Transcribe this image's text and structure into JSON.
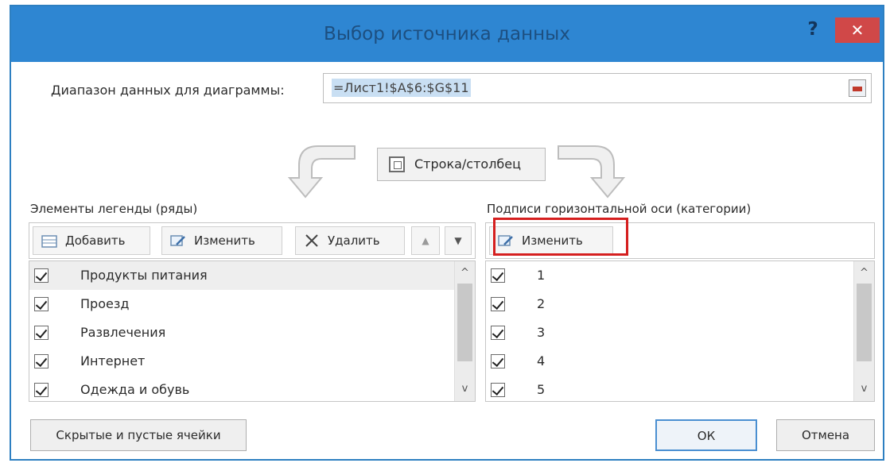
{
  "window": {
    "title": "Выбор источника данных",
    "help_label": "?",
    "close_label": "✕"
  },
  "data_range": {
    "label": "Диапазон данных для диаграммы:",
    "value": "=Лист1!$A$6:$G$11",
    "picker_icon": "range-collapse-icon"
  },
  "switch_row_col": {
    "label": "Строка/столбец",
    "icon": "switch-row-column-icon"
  },
  "legend_panel": {
    "label": "Элементы легенды (ряды)",
    "add_label": "Добавить",
    "edit_label": "Изменить",
    "delete_label": "Удалить",
    "move_up_label": "▲",
    "move_down_label": "▼",
    "items": [
      {
        "label": "Продукты питания",
        "checked": true,
        "selected": true
      },
      {
        "label": "Проезд",
        "checked": true
      },
      {
        "label": "Развлечения",
        "checked": true
      },
      {
        "label": "Интернет",
        "checked": true
      },
      {
        "label": "Одежда и обувь",
        "checked": true
      }
    ]
  },
  "axis_panel": {
    "label": "Подписи горизонтальной оси (категории)",
    "edit_label": "Изменить",
    "items": [
      {
        "label": "1",
        "checked": true
      },
      {
        "label": "2",
        "checked": true
      },
      {
        "label": "3",
        "checked": true
      },
      {
        "label": "4",
        "checked": true
      },
      {
        "label": "5",
        "checked": true
      }
    ]
  },
  "footer": {
    "hidden_cells_label": "Скрытые и пустые ячейки",
    "ok_label": "ОК",
    "cancel_label": "Отмена"
  },
  "scroll": {
    "up_label": "^",
    "down_label": "v"
  },
  "colors": {
    "titlebar": "#2e86d2",
    "close_button": "#d04848",
    "highlight": "#d51f1f"
  }
}
